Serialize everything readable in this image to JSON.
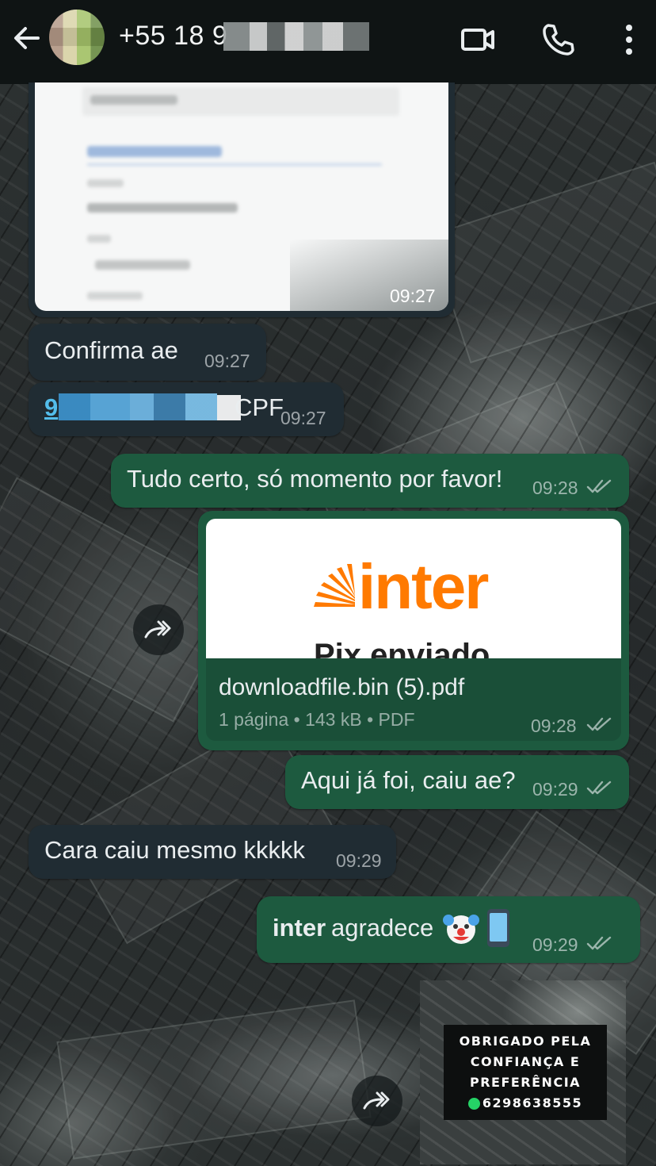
{
  "header": {
    "contact_name": "+55 18 9"
  },
  "messages": {
    "image_msg": {
      "time": "09:27"
    },
    "confirma": {
      "text": "Confirma ae",
      "time": "09:27"
    },
    "cpf": {
      "prefix": "9",
      "suffix": "CPF",
      "time": "09:27"
    },
    "tudo_certo": {
      "text": "Tudo certo, só momento por favor!",
      "time": "09:28"
    },
    "pdf": {
      "preview_brand": "inter",
      "preview_text": "Pix enviado",
      "filename": "downloadfile.bin (5).pdf",
      "meta": "1 página • 143 kB • PDF",
      "time": "09:28"
    },
    "aqui_ja_foi": {
      "text": "Aqui já foi, caiu ae?",
      "time": "09:29"
    },
    "cara_caiu": {
      "text": "Cara caiu mesmo kkkkk",
      "time": "09:29"
    },
    "inter_agradece": {
      "brand": "inter",
      "text": "agradece",
      "time": "09:29"
    }
  },
  "sticker": {
    "lines": [
      "OBRIGADO PELA",
      "CONFIANÇA E",
      "PREFERÊNCIA"
    ],
    "phone": "6298638555"
  },
  "icons": {
    "back": "arrow-left-icon",
    "video": "video-call-icon",
    "call": "phone-icon",
    "menu": "more-vert-icon",
    "forward": "forward-icon",
    "read": "double-check-icon",
    "clown": "clown-face-emoji",
    "phone_emoji": "mobile-phone-emoji"
  },
  "colors": {
    "header_bg": "#0f1414",
    "incoming_bubble": "#202c33",
    "outgoing_bubble": "#1d5a3f",
    "inter_orange": "#ff7a00",
    "link_blue": "#53bdeb"
  }
}
